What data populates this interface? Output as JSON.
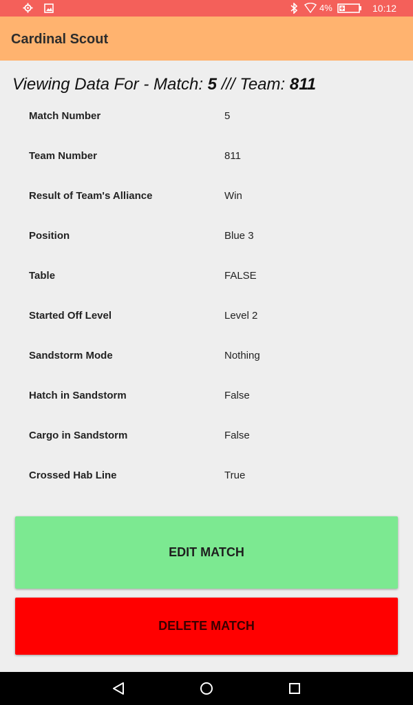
{
  "status_bar": {
    "left_icons": [
      "settings-icon",
      "image-icon"
    ],
    "right_icons": [
      "bluetooth-icon",
      "wifi-icon",
      "battery-icon"
    ],
    "battery_percent": "4%",
    "time": "10:12",
    "background": "#f4605a"
  },
  "app_bar": {
    "title": "Cardinal Scout",
    "background": "#ffb36f"
  },
  "heading": {
    "prefix": "Viewing Data For - Match: ",
    "match": "5",
    "separator": " /// Team: ",
    "team": "811"
  },
  "rows": [
    {
      "label": "Match Number",
      "value": "5"
    },
    {
      "label": "Team Number",
      "value": "811"
    },
    {
      "label": "Result of Team's Alliance",
      "value": "Win"
    },
    {
      "label": "Position",
      "value": "Blue 3"
    },
    {
      "label": "Table",
      "value": "FALSE"
    },
    {
      "label": "Started Off Level",
      "value": "Level 2"
    },
    {
      "label": "Sandstorm Mode",
      "value": "Nothing"
    },
    {
      "label": "Hatch in Sandstorm",
      "value": "False"
    },
    {
      "label": "Cargo in Sandstorm",
      "value": "False"
    },
    {
      "label": "Crossed Hab Line",
      "value": "True"
    }
  ],
  "buttons": {
    "edit": {
      "label": "EDIT MATCH",
      "color": "#7ce991"
    },
    "delete": {
      "label": "DELETE MATCH",
      "color": "#ff0000"
    }
  },
  "nav_bar": {
    "icons": [
      "back-icon",
      "home-icon",
      "recents-icon"
    ]
  }
}
